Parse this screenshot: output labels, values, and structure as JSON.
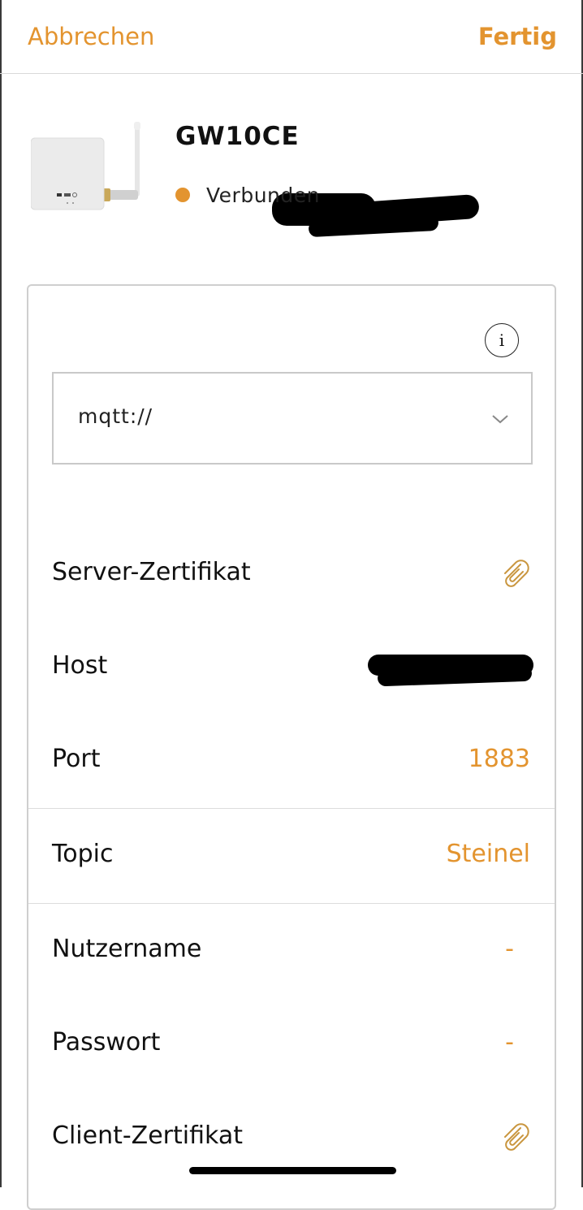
{
  "nav": {
    "cancel_label": "Abbrechen",
    "done_label": "Fertig"
  },
  "device": {
    "name": "GW10CE",
    "status": "Verbunden"
  },
  "broker": {
    "info_glyph": "i",
    "protocol": "mqtt://"
  },
  "fields": {
    "server_cert_label": "Server-Zertifikat",
    "host_label": "Host",
    "port_label": "Port",
    "port_value": "1883",
    "topic_label": "Topic",
    "topic_value": "Steinel",
    "username_label": "Nutzername",
    "username_value": "-",
    "password_label": "Passwort",
    "password_value": "-",
    "client_cert_label": "Client-Zertifikat"
  },
  "colors": {
    "accent": "#e3942f",
    "border": "#cfcfcf",
    "divider": "#dcdcdc"
  },
  "icons": [
    "info-icon",
    "chevron-down-icon",
    "paperclip-icon"
  ]
}
